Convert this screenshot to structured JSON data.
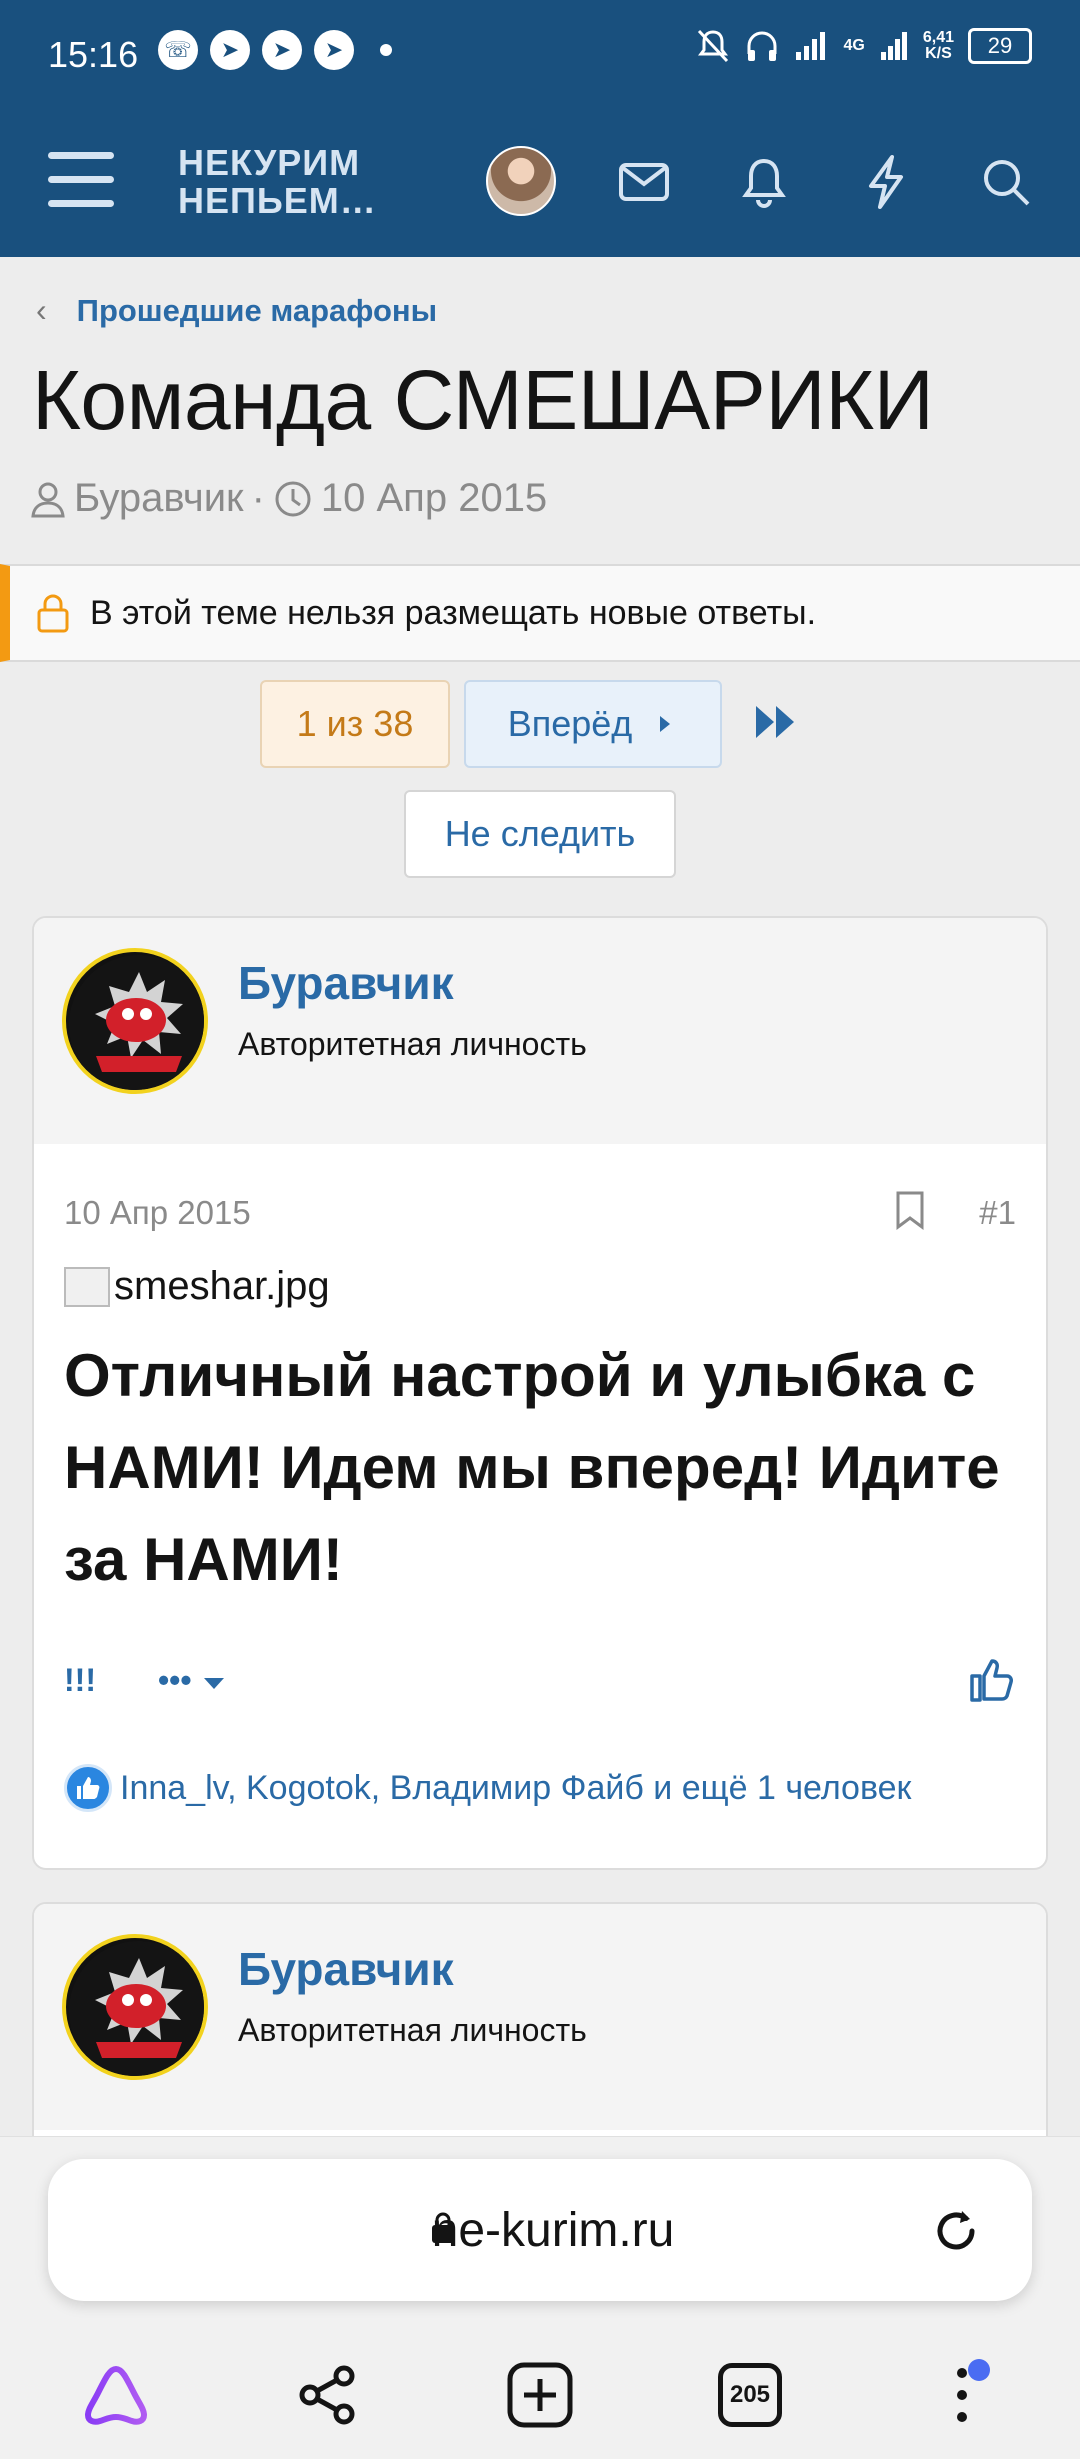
{
  "status_bar": {
    "time": "15:16",
    "network": "4G",
    "speed_value": "6,41",
    "speed_unit": "K/S",
    "battery": "29"
  },
  "header": {
    "logo_line1": "НЕКУРИМ",
    "logo_line2": "НЕПЬЕМ…"
  },
  "thread": {
    "breadcrumb": "Прошедшие марафоны",
    "title": "Команда СМЕШАРИКИ",
    "author": "Буравчик",
    "separator": "·",
    "date": "10 Апр 2015",
    "locked_notice": "В этой теме нельзя размещать новые ответы."
  },
  "pager": {
    "current": "1 из 38",
    "next": "Вперёд",
    "unwatch": "Не следить"
  },
  "posts": [
    {
      "author": "Буравчик",
      "role": "Авторитетная личность",
      "date": "10 Апр 2015",
      "number": "#1",
      "image_alt": "smeshar.jpg",
      "text": "Отличный настрой и улыбка с НАМИ! Идем мы вперед! Идите за НАМИ!",
      "action_reactions": "!!!",
      "action_more": "•••",
      "reactions_text": "Inna_lv, Kogotok, Владимир Файб и ещё 1 человек"
    },
    {
      "author": "Буравчик",
      "role": "Авторитетная личность"
    }
  ],
  "browser": {
    "url": "ne-kurim.ru",
    "tabs_count": "205"
  },
  "colors": {
    "header_bg": "#19507e",
    "link": "#2a6aa6",
    "locked_accent": "#f39a12",
    "pager_current_bg": "#fdf1e2",
    "reaction_like": "#2a86e0"
  }
}
